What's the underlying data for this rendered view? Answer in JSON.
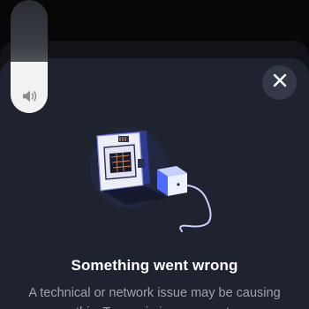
{
  "dialog": {
    "title": "Something went wrong",
    "message": "A technical or network issue may be causing this. Try again in a moment."
  },
  "volume": {
    "level": 0.45
  },
  "icons": {
    "volume": "speaker-icon",
    "close": "close-icon",
    "illustration": "unplugged-device-illustration"
  },
  "colors": {
    "sheet_background": "#1f2330",
    "close_button": "#343947",
    "illustration_accent": "#4f6bff"
  }
}
